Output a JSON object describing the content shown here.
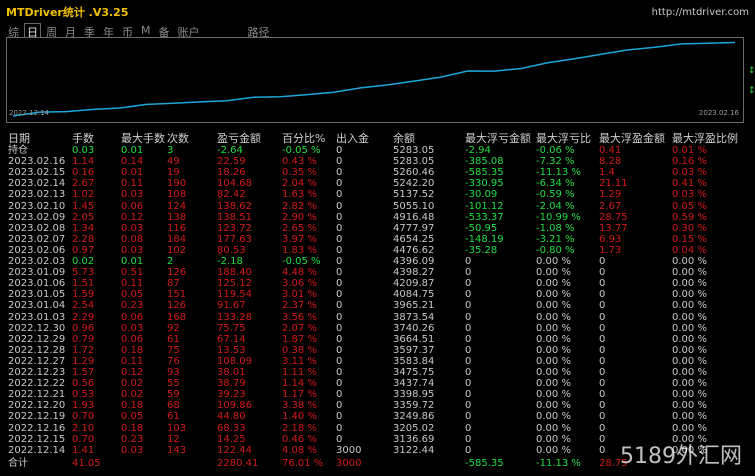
{
  "window": {
    "title": "MTDriver统计 .V3.25",
    "url": "http://mtdriver.com"
  },
  "tabs": [
    "综",
    "日",
    "周",
    "月",
    "季",
    "年",
    "币",
    "M",
    "备",
    "账户",
    "路径"
  ],
  "chart": {
    "start_date": "2022.12.14",
    "end_date": "2023.02.16"
  },
  "columns": [
    "日期",
    "手数",
    "最大手数",
    "次数",
    "盈亏金额",
    "百分比%",
    "出入金",
    "余额",
    "最大浮亏金额",
    "最大浮亏比",
    "最大浮盈金额",
    "最大浮盈比例"
  ],
  "rows": [
    {
      "date": "持仓",
      "lots": "0.03",
      "maxlots": "0.01",
      "count": "3",
      "pnl": "-2.64",
      "pct": "-0.05 %",
      "io": "0",
      "bal": "5283.05",
      "fl": "-2.94",
      "flp": "-0.06 %",
      "fp": "0.41",
      "fpp": "0.01 %",
      "c": "g"
    },
    {
      "date": "2023.02.16",
      "lots": "1.14",
      "maxlots": "0.14",
      "count": "49",
      "pnl": "22.59",
      "pct": "0.43 %",
      "io": "0",
      "bal": "5283.05",
      "fl": "-385.08",
      "flp": "-7.32 %",
      "fp": "8.28",
      "fpp": "0.16 %",
      "c": "r"
    },
    {
      "date": "2023.02.15",
      "lots": "0.16",
      "maxlots": "0.01",
      "count": "19",
      "pnl": "18.26",
      "pct": "0.35 %",
      "io": "0",
      "bal": "5260.46",
      "fl": "-585.35",
      "flp": "-11.13 %",
      "fp": "1.4",
      "fpp": "0.03 %",
      "c": "r"
    },
    {
      "date": "2023.02.14",
      "lots": "2.67",
      "maxlots": "0.11",
      "count": "190",
      "pnl": "104.68",
      "pct": "2.04 %",
      "io": "0",
      "bal": "5242.20",
      "fl": "-330.95",
      "flp": "-6.34 %",
      "fp": "21.11",
      "fpp": "0.41 %",
      "c": "r"
    },
    {
      "date": "2023.02.13",
      "lots": "1.02",
      "maxlots": "0.03",
      "count": "108",
      "pnl": "82.42",
      "pct": "1.63 %",
      "io": "0",
      "bal": "5137.52",
      "fl": "-30.09",
      "flp": "-0.59 %",
      "fp": "1.29",
      "fpp": "0.03 %",
      "c": "r"
    },
    {
      "date": "2023.02.10",
      "lots": "1.45",
      "maxlots": "0.06",
      "count": "124",
      "pnl": "138.62",
      "pct": "2.82 %",
      "io": "0",
      "bal": "5055.10",
      "fl": "-101.12",
      "flp": "-2.04 %",
      "fp": "2.67",
      "fpp": "0.05 %",
      "c": "r"
    },
    {
      "date": "2023.02.09",
      "lots": "2.05",
      "maxlots": "0.12",
      "count": "138",
      "pnl": "138.51",
      "pct": "2.90 %",
      "io": "0",
      "bal": "4916.48",
      "fl": "-533.37",
      "flp": "-10.99 %",
      "fp": "28.75",
      "fpp": "0.59 %",
      "c": "r"
    },
    {
      "date": "2023.02.08",
      "lots": "1.34",
      "maxlots": "0.03",
      "count": "116",
      "pnl": "123.72",
      "pct": "2.65 %",
      "io": "0",
      "bal": "4777.97",
      "fl": "-50.95",
      "flp": "-1.08 %",
      "fp": "13.77",
      "fpp": "0.30 %",
      "c": "r"
    },
    {
      "date": "2023.02.07",
      "lots": "2.28",
      "maxlots": "0.08",
      "count": "184",
      "pnl": "177.63",
      "pct": "3.97 %",
      "io": "0",
      "bal": "4654.25",
      "fl": "-148.19",
      "flp": "-3.21 %",
      "fp": "6.93",
      "fpp": "0.15 %",
      "c": "r"
    },
    {
      "date": "2023.02.06",
      "lots": "0.97",
      "maxlots": "0.03",
      "count": "102",
      "pnl": "80.53",
      "pct": "1.83 %",
      "io": "0",
      "bal": "4476.62",
      "fl": "-35.28",
      "flp": "-0.80 %",
      "fp": "1.73",
      "fpp": "0.04 %",
      "c": "r"
    },
    {
      "date": "2023.02.03",
      "lots": "0.02",
      "maxlots": "0.01",
      "count": "2",
      "pnl": "-2.18",
      "pct": "-0.05 %",
      "io": "0",
      "bal": "4396.09",
      "fl": "0",
      "flp": "0.00 %",
      "fp": "0",
      "fpp": "0.00 %",
      "c": "g"
    },
    {
      "date": "2023.01.09",
      "lots": "5.73",
      "maxlots": "0.51",
      "count": "126",
      "pnl": "188.40",
      "pct": "4.48 %",
      "io": "0",
      "bal": "4398.27",
      "fl": "0",
      "flp": "0.00 %",
      "fp": "0",
      "fpp": "0.00 %",
      "c": "r"
    },
    {
      "date": "2023.01.06",
      "lots": "1.51",
      "maxlots": "0.11",
      "count": "87",
      "pnl": "125.12",
      "pct": "3.06 %",
      "io": "0",
      "bal": "4209.87",
      "fl": "0",
      "flp": "0.00 %",
      "fp": "0",
      "fpp": "0.00 %",
      "c": "r"
    },
    {
      "date": "2023.01.05",
      "lots": "1.59",
      "maxlots": "0.05",
      "count": "151",
      "pnl": "119.54",
      "pct": "3.01 %",
      "io": "0",
      "bal": "4084.75",
      "fl": "0",
      "flp": "0.00 %",
      "fp": "0",
      "fpp": "0.00 %",
      "c": "r"
    },
    {
      "date": "2023.01.04",
      "lots": "2.54",
      "maxlots": "0.23",
      "count": "126",
      "pnl": "91.67",
      "pct": "2.37 %",
      "io": "0",
      "bal": "3965.21",
      "fl": "0",
      "flp": "0.00 %",
      "fp": "0",
      "fpp": "0.00 %",
      "c": "r"
    },
    {
      "date": "2023.01.03",
      "lots": "2.29",
      "maxlots": "0.06",
      "count": "168",
      "pnl": "133.28",
      "pct": "3.56 %",
      "io": "0",
      "bal": "3873.54",
      "fl": "0",
      "flp": "0.00 %",
      "fp": "0",
      "fpp": "0.00 %",
      "c": "r"
    },
    {
      "date": "2022.12.30",
      "lots": "0.96",
      "maxlots": "0.03",
      "count": "92",
      "pnl": "75.75",
      "pct": "2.07 %",
      "io": "0",
      "bal": "3740.26",
      "fl": "0",
      "flp": "0.00 %",
      "fp": "0",
      "fpp": "0.00 %",
      "c": "r"
    },
    {
      "date": "2022.12.29",
      "lots": "0.79",
      "maxlots": "0.06",
      "count": "61",
      "pnl": "67.14",
      "pct": "1.87 %",
      "io": "0",
      "bal": "3664.51",
      "fl": "0",
      "flp": "0.00 %",
      "fp": "0",
      "fpp": "0.00 %",
      "c": "r"
    },
    {
      "date": "2022.12.28",
      "lots": "1.72",
      "maxlots": "0.18",
      "count": "75",
      "pnl": "13.53",
      "pct": "0.38 %",
      "io": "0",
      "bal": "3597.37",
      "fl": "0",
      "flp": "0.00 %",
      "fp": "0",
      "fpp": "0.00 %",
      "c": "r"
    },
    {
      "date": "2022.12.27",
      "lots": "1.29",
      "maxlots": "0.11",
      "count": "76",
      "pnl": "108.09",
      "pct": "3.11 %",
      "io": "0",
      "bal": "3583.84",
      "fl": "0",
      "flp": "0.00 %",
      "fp": "0",
      "fpp": "0.00 %",
      "c": "r"
    },
    {
      "date": "2022.12.23",
      "lots": "1.57",
      "maxlots": "0.12",
      "count": "93",
      "pnl": "38.01",
      "pct": "1.11 %",
      "io": "0",
      "bal": "3475.75",
      "fl": "0",
      "flp": "0.00 %",
      "fp": "0",
      "fpp": "0.00 %",
      "c": "r"
    },
    {
      "date": "2022.12.22",
      "lots": "0.56",
      "maxlots": "0.02",
      "count": "55",
      "pnl": "38.79",
      "pct": "1.14 %",
      "io": "0",
      "bal": "3437.74",
      "fl": "0",
      "flp": "0.00 %",
      "fp": "0",
      "fpp": "0.00 %",
      "c": "r"
    },
    {
      "date": "2022.12.21",
      "lots": "0.53",
      "maxlots": "0.02",
      "count": "59",
      "pnl": "39.23",
      "pct": "1.17 %",
      "io": "0",
      "bal": "3398.95",
      "fl": "0",
      "flp": "0.00 %",
      "fp": "0",
      "fpp": "0.00 %",
      "c": "r"
    },
    {
      "date": "2022.12.20",
      "lots": "1.93",
      "maxlots": "0.18",
      "count": "68",
      "pnl": "109.86",
      "pct": "3.38 %",
      "io": "0",
      "bal": "3359.72",
      "fl": "0",
      "flp": "0.00 %",
      "fp": "0",
      "fpp": "0.00 %",
      "c": "r"
    },
    {
      "date": "2022.12.19",
      "lots": "0.70",
      "maxlots": "0.05",
      "count": "61",
      "pnl": "44.80",
      "pct": "1.40 %",
      "io": "0",
      "bal": "3249.86",
      "fl": "0",
      "flp": "0.00 %",
      "fp": "0",
      "fpp": "0.00 %",
      "c": "r"
    },
    {
      "date": "2022.12.16",
      "lots": "2.10",
      "maxlots": "0.18",
      "count": "103",
      "pnl": "68.33",
      "pct": "2.18 %",
      "io": "0",
      "bal": "3205.02",
      "fl": "0",
      "flp": "0.00 %",
      "fp": "0",
      "fpp": "0.00 %",
      "c": "r"
    },
    {
      "date": "2022.12.15",
      "lots": "0.70",
      "maxlots": "0.23",
      "count": "12",
      "pnl": "14.25",
      "pct": "0.46 %",
      "io": "0",
      "bal": "3136.69",
      "fl": "0",
      "flp": "0.00 %",
      "fp": "0",
      "fpp": "0.00 %",
      "c": "r"
    },
    {
      "date": "2022.12.14",
      "lots": "1.41",
      "maxlots": "0.03",
      "count": "143",
      "pnl": "122.44",
      "pct": "4.08 %",
      "io": "3000",
      "bal": "3122.44",
      "fl": "0",
      "flp": "0.00 %",
      "fp": "0",
      "fpp": "0.00 %",
      "c": "r"
    }
  ],
  "summary": {
    "label": "合计",
    "lots": "41.05",
    "pnl": "2280.41",
    "pct": "76.01 %",
    "io": "3000",
    "fl": "-585.35",
    "flp": "-11.13 %",
    "fp": "28.75"
  },
  "watermark": "5189外汇网",
  "colors": {
    "up": "#d11a1a",
    "down": "#22dd44",
    "curve": "#1ea7d8",
    "title": "#f0c000"
  }
}
